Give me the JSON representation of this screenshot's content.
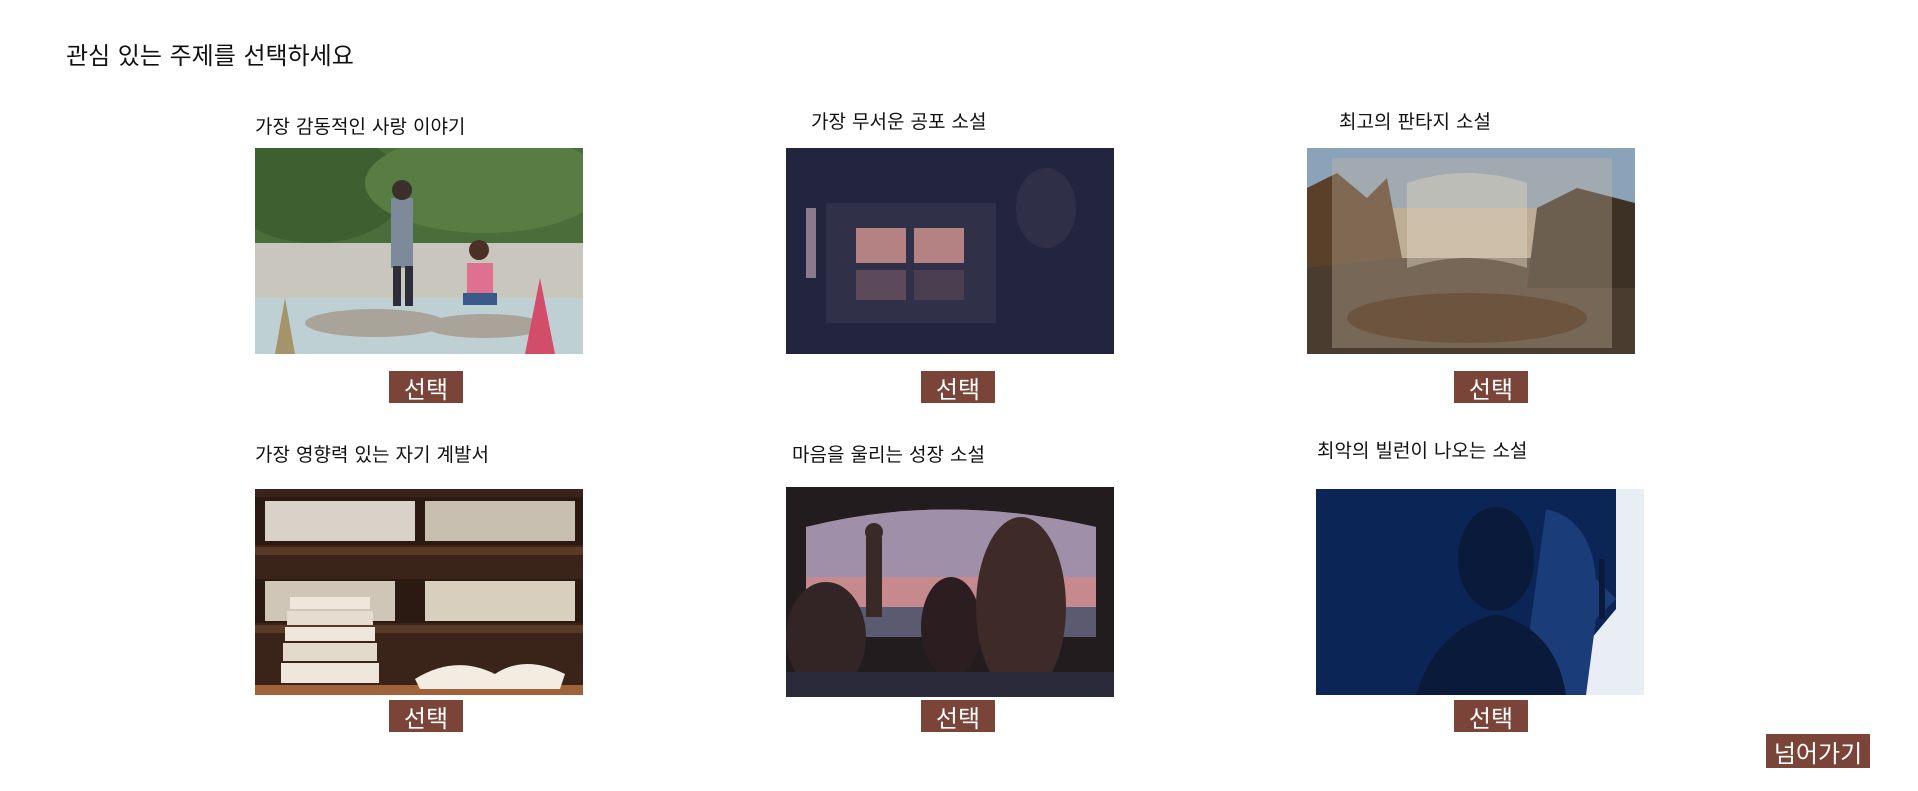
{
  "page": {
    "title": "관심 있는 주제를 선택하세요"
  },
  "theme": {
    "button_color": "#7a4438",
    "button_text_color": "#ffffff"
  },
  "topics": [
    {
      "title": "가장 감동적인 사랑 이야기",
      "button_label": "선택",
      "image": "anime-couple-by-stream"
    },
    {
      "title": "가장 무서운 공포 소설",
      "button_label": "선택",
      "image": "dark-haunted-window"
    },
    {
      "title": "최고의 판타지 소설",
      "button_label": "선택",
      "image": "rocky-seashore-with-open-book"
    },
    {
      "title": "가장 영향력 있는 자기 계발서",
      "button_label": "선택",
      "image": "bookshelf-and-stacked-books"
    },
    {
      "title": "마음을 울리는 성장 소설",
      "button_label": "선택",
      "image": "friends-in-car-at-sunset"
    },
    {
      "title": "최악의 빌런이 나오는 소설",
      "button_label": "선택",
      "image": "silhouette-villain-shushing"
    }
  ],
  "skip_label": "넘어가기"
}
